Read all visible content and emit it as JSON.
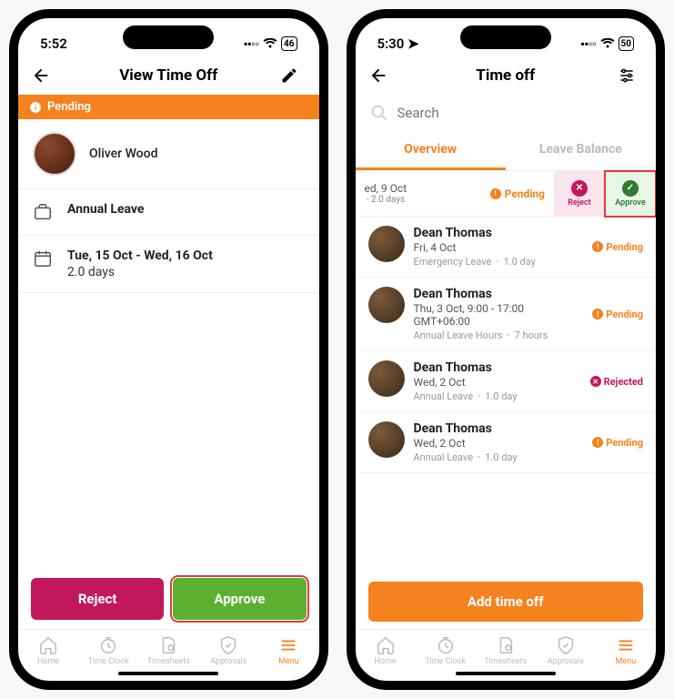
{
  "left": {
    "status": {
      "time": "5:52",
      "battery": "46"
    },
    "nav": {
      "title": "View Time Off"
    },
    "banner": "Pending",
    "user": {
      "name": "Oliver Wood"
    },
    "leave_type": "Annual Leave",
    "date_range": "Tue, 15 Oct - Wed, 16 Oct",
    "days": "2.0 days",
    "reject": "Reject",
    "approve": "Approve"
  },
  "right": {
    "status": {
      "time": "5:30",
      "battery": "50"
    },
    "nav": {
      "title": "Time off"
    },
    "search_placeholder": "Search",
    "tabs": {
      "overview": "Overview",
      "balance": "Leave Balance"
    },
    "swipe": {
      "date": "ed, 9 Oct",
      "days": "2.0 days",
      "pending": "Pending",
      "reject": "Reject",
      "approve": "Approve"
    },
    "items": [
      {
        "name": "Dean Thomas",
        "date": "Fri, 4 Oct",
        "type": "Emergency Leave",
        "dur": "1.0 day",
        "status": "Pending",
        "statusClass": "pending"
      },
      {
        "name": "Dean Thomas",
        "date": "Thu, 3 Oct, 9:00 - 17:00 GMT+06:00",
        "type": "Annual Leave Hours",
        "dur": "7 hours",
        "status": "Pending",
        "statusClass": "pending"
      },
      {
        "name": "Dean Thomas",
        "date": "Wed, 2 Oct",
        "type": "Annual Leave",
        "dur": "1.0 day",
        "status": "Rejected",
        "statusClass": "rejected"
      },
      {
        "name": "Dean Thomas",
        "date": "Wed, 2 Oct",
        "type": "Annual Leave",
        "dur": "1.0 day",
        "status": "Pending",
        "statusClass": "pending"
      }
    ],
    "add": "Add time off"
  },
  "tabbar": [
    "Home",
    "Time Clock",
    "Timesheets",
    "Approvals",
    "Menu"
  ]
}
